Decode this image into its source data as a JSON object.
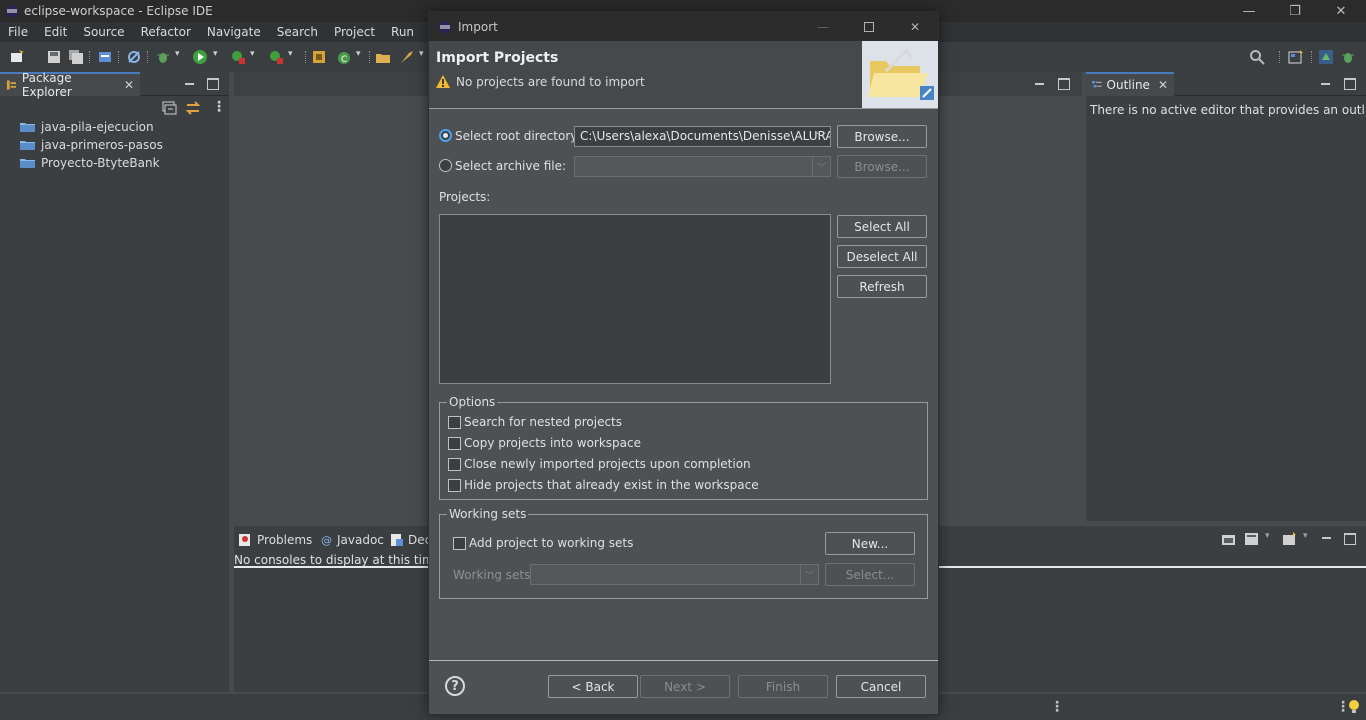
{
  "window": {
    "title": "eclipse-workspace - Eclipse IDE",
    "minimize": "—",
    "restore": "❐",
    "close": "✕"
  },
  "menu": [
    "File",
    "Edit",
    "Source",
    "Refactor",
    "Navigate",
    "Search",
    "Project",
    "Run"
  ],
  "package_explorer": {
    "tab_label": "Package Explorer",
    "items": [
      "java-pila-ejecucion",
      "java-primeros-pasos",
      "Proyecto-BtyteBank"
    ]
  },
  "outline": {
    "tab_label": "Outline",
    "message": "There is no active editor that provides an outline."
  },
  "bottom_panel": {
    "tabs": [
      "Problems",
      "Javadoc",
      "Dec"
    ],
    "message": "No consoles to display at this time."
  },
  "dialog": {
    "title": "Import",
    "header_title": "Import Projects",
    "header_message": "No projects are found to import",
    "root_directory_label": "Select root directory:",
    "root_directory_value": "C:\\Users\\alexa\\Documents\\Denisse\\ALURA-",
    "archive_file_label": "Select archive file:",
    "browse_label": "Browse...",
    "projects_label": "Projects:",
    "select_all": "Select All",
    "deselect_all": "Deselect All",
    "refresh": "Refresh",
    "options_title": "Options",
    "options": [
      "Search for nested projects",
      "Copy projects into workspace",
      "Close newly imported projects upon completion",
      "Hide projects that already exist in the workspace"
    ],
    "working_sets_title": "Working sets",
    "add_to_working_sets": "Add project to working sets",
    "new_label": "New...",
    "working_sets_label": "Working sets:",
    "select_label": "Select...",
    "help": "?",
    "back": "< Back",
    "next": "Next >",
    "finish": "Finish",
    "cancel": "Cancel"
  }
}
